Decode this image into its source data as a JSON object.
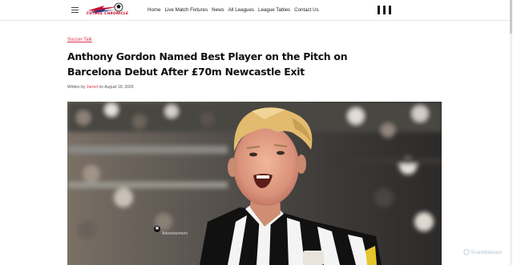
{
  "header": {
    "logo_text": "FUTBOL CHRONICLE",
    "nav": [
      "Home",
      "Live Match Fixtures",
      "News",
      "All Leagues",
      "League Tables",
      "Contact Us"
    ]
  },
  "article": {
    "category": "Soccer Talk",
    "title": "Anthony Gordon Named Best Player on the Pitch on Barcelona Debut After £70m Newcastle Exit",
    "byline_prefix": "Written by",
    "author": "Jarrod",
    "byline_on": "on",
    "date": "August 18, 2026"
  },
  "overlay": {
    "close_symbol": "✖",
    "ad_label": "Advertisement"
  },
  "watermark": "ScanMalware",
  "colors": {
    "accent": "#e0344b",
    "nav_text": "#222222",
    "title_text": "#111111"
  }
}
